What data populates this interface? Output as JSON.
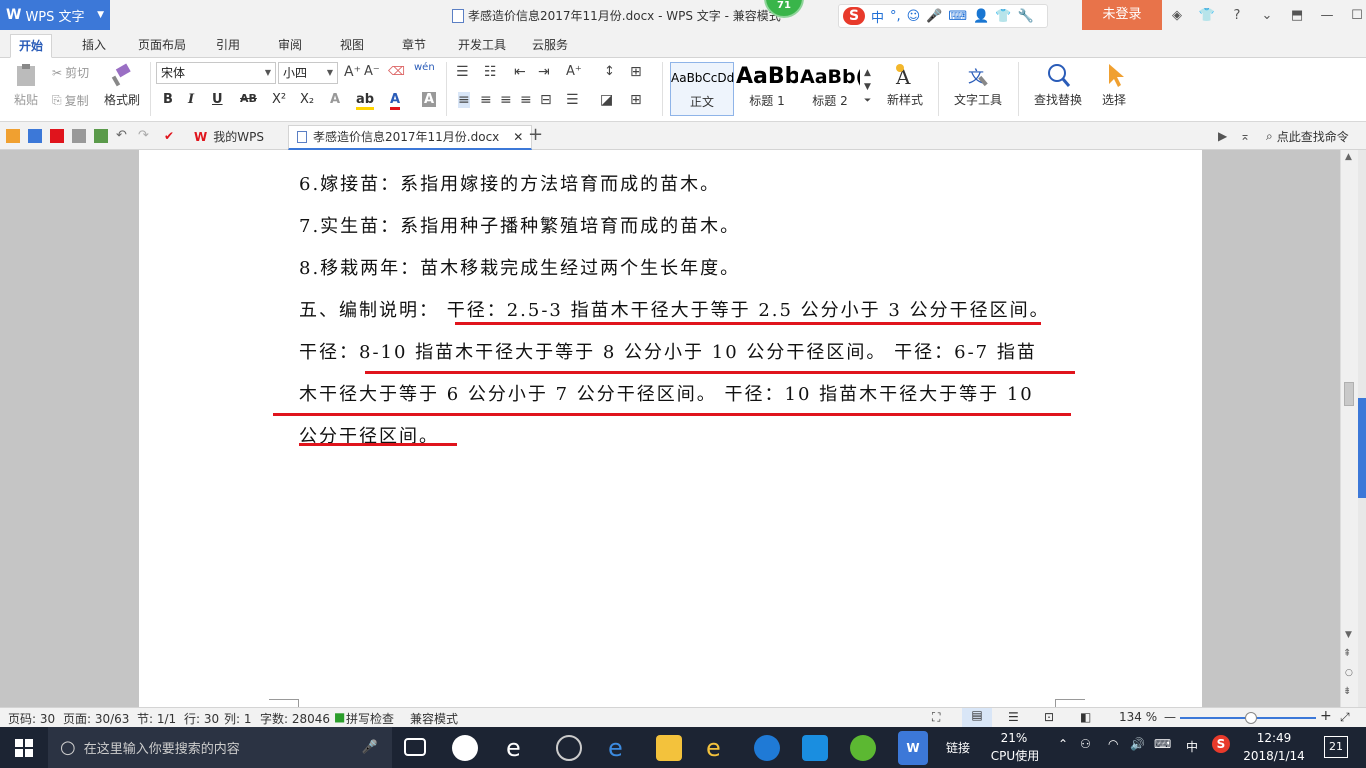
{
  "titlebar": {
    "app_name": "WPS 文字",
    "doc_title": "孝感造价信息2017年11月份.docx - WPS 文字 - 兼容模式",
    "badge": "71",
    "login": "未登录",
    "ime": {
      "lang": "中",
      "punct": "°,"
    }
  },
  "menu": {
    "tabs": [
      "开始",
      "插入",
      "页面布局",
      "引用",
      "审阅",
      "视图",
      "章节",
      "开发工具",
      "云服务"
    ],
    "active_tab": "开始"
  },
  "ribbon": {
    "paste": "粘贴",
    "cut": "剪切",
    "copy": "复制",
    "format_painter": "格式刷",
    "font_name": "宋体",
    "font_size": "小四",
    "styles": [
      {
        "preview": "AaBbCcDd",
        "label": "正文"
      },
      {
        "preview": "AaBb",
        "label": "标题 1"
      },
      {
        "preview": "AaBb(",
        "label": "标题 2"
      }
    ],
    "new_style": "新样式",
    "text_tools": "文字工具",
    "find_replace": "查找替换",
    "select": "选择",
    "bold": "B",
    "italic": "I",
    "underline": "U",
    "strike": "AB",
    "superscript": "X²",
    "subscript": "X₂"
  },
  "tabbar": {
    "my_wps": "我的WPS",
    "doc_tab": "孝感造价信息2017年11月份.docx",
    "find_command": "点此查找命令"
  },
  "document": {
    "lines": [
      "6.嫁接苗：系指用嫁接的方法培育而成的苗木。",
      "7.实生苗：系指用种子播种繁殖培育而成的苗木。",
      "8.移栽两年：苗木移栽完成生经过两个生长年度。",
      "五、编制说明： 干径：2.5-3 指苗木干径大于等于 2.5 公分小于 3 公分干径区间。",
      "干径：8-10 指苗木干径大于等于 8 公分小于 10 公分干径区间。  干径：6-7 指苗",
      "木干径大于等于 6 公分小于 7 公分干径区间。   干径：10 指苗木干径大于等于 10",
      "公分干径区间。"
    ]
  },
  "status": {
    "page_code": "页码: 30",
    "page": "页面: 30/63",
    "section": "节: 1/1",
    "row": "行: 30",
    "col": "列: 1",
    "word_count": "字数: 28046",
    "spell_check": "拼写检查",
    "compat": "兼容模式",
    "zoom": "134 %"
  },
  "taskbar": {
    "search_placeholder": "在这里输入你要搜索的内容",
    "link_label": "链接",
    "cpu_percent": "21%",
    "cpu_label": "CPU使用",
    "ime_lang": "中",
    "time": "12:49",
    "date": "2018/1/14",
    "notif_count": "21"
  },
  "colors": {
    "accent": "#3c78d8",
    "login_btn": "#e8734a",
    "red_underline": "#e0141c",
    "taskbar": "#1c2433"
  }
}
